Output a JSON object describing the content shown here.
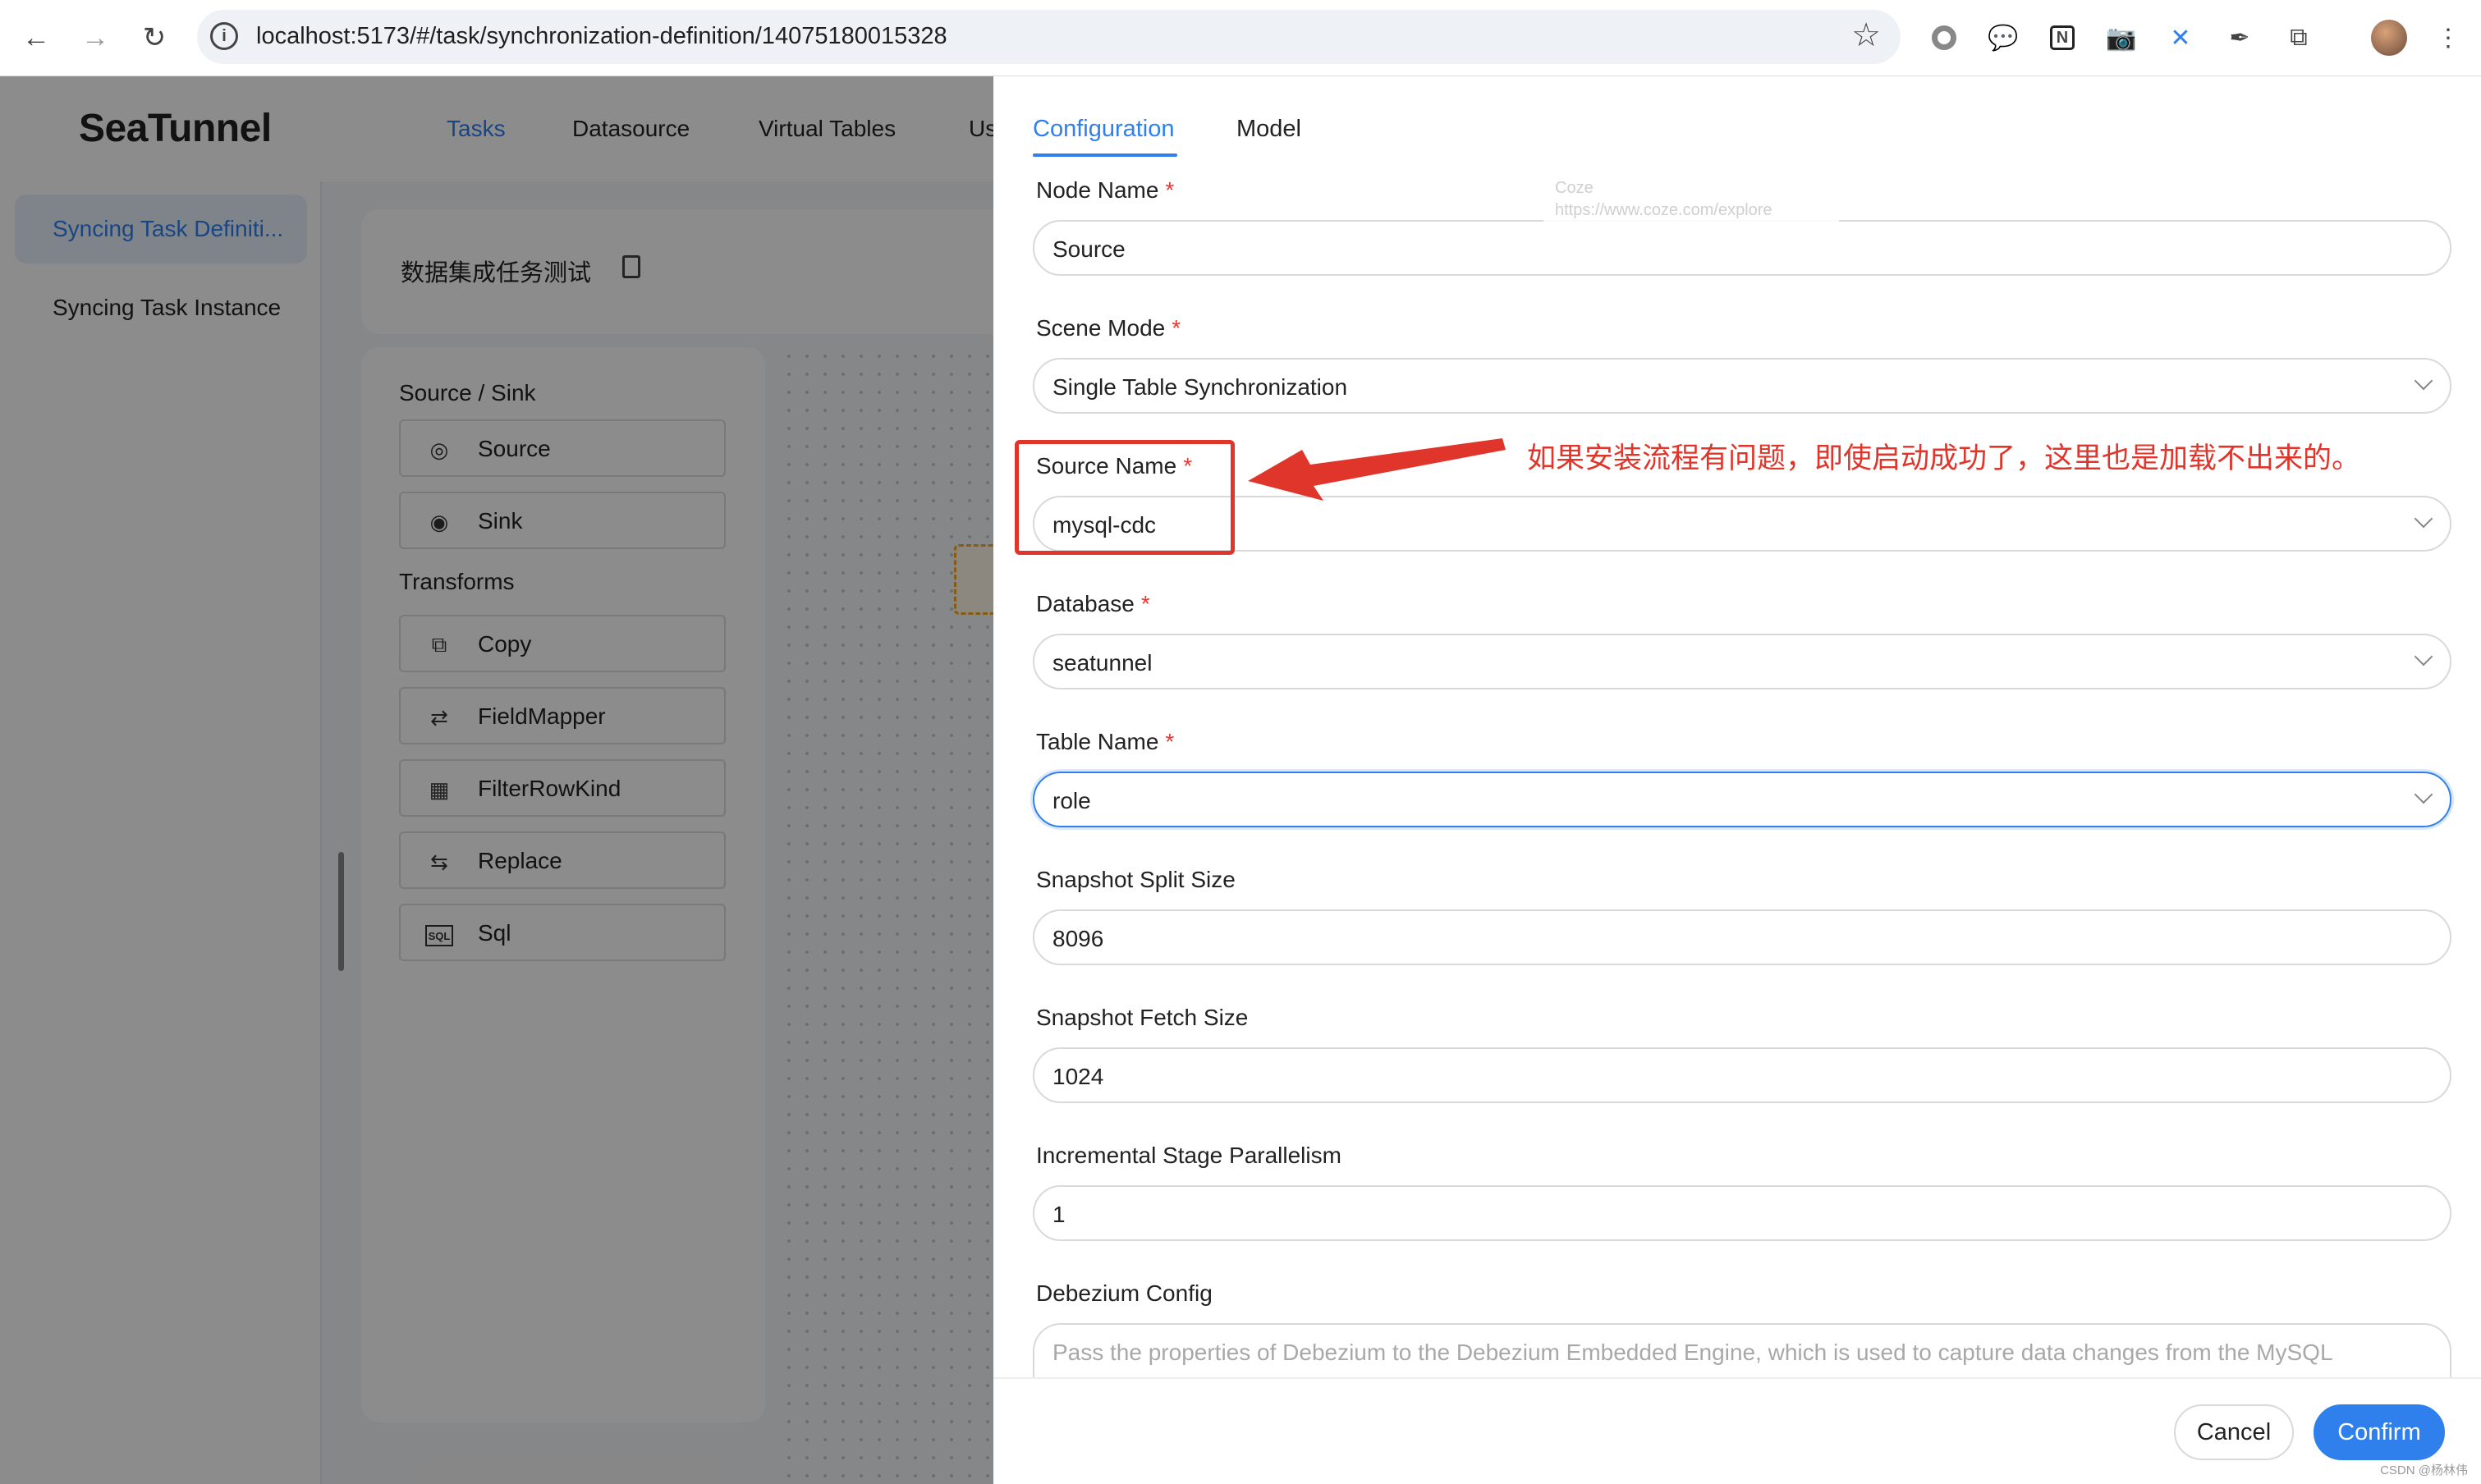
{
  "browser": {
    "url": "localhost:5173/#/task/synchronization-definition/14075180015328",
    "back_icon": "←",
    "forward_icon": "→",
    "reload_icon": "↻",
    "star_icon": "☆"
  },
  "app": {
    "logo": "SeaTunnel",
    "topnav": [
      "Tasks",
      "Datasource",
      "Virtual Tables",
      "Us"
    ],
    "sidebar": [
      "Syncing Task Definiti...",
      "Syncing Task Instance"
    ],
    "task_name": "数据集成任务测试",
    "palette": {
      "source_sink_heading": "Source / Sink",
      "source_sink": [
        "Source",
        "Sink"
      ],
      "transforms_heading": "Transforms",
      "transforms": [
        "Copy",
        "FieldMapper",
        "FilterRowKind",
        "Replace",
        "Sql"
      ]
    }
  },
  "drawer": {
    "tabs": [
      "Configuration",
      "Model"
    ],
    "fields": {
      "node_name": {
        "label": "Node Name",
        "value": "Source"
      },
      "scene_mode": {
        "label": "Scene Mode",
        "value": "Single Table Synchronization"
      },
      "source_name": {
        "label": "Source Name",
        "value": "mysql-cdc"
      },
      "database": {
        "label": "Database",
        "value": "seatunnel"
      },
      "table_name": {
        "label": "Table Name",
        "value": "role"
      },
      "snapshot_split_size": {
        "label": "Snapshot Split Size",
        "value": "8096"
      },
      "snapshot_fetch_size": {
        "label": "Snapshot Fetch Size",
        "value": "1024"
      },
      "incremental_parallelism": {
        "label": "Incremental Stage Parallelism",
        "value": "1"
      },
      "debezium_config": {
        "label": "Debezium Config",
        "placeholder": "Pass the properties of Debezium to the Debezium Embedded Engine, which is used to capture data changes from the MySQL"
      }
    },
    "required_mark": "*",
    "cancel": "Cancel",
    "confirm": "Confirm"
  },
  "overlay": {
    "coze_title": "Coze",
    "coze_url": "https://www.coze.com/explore",
    "annotation_text": "如果安装流程有问题，即使启动成功了，这里也是加载不出来的。",
    "annotation_color": "#e0352b"
  },
  "watermark": "CSDN @杨林伟",
  "colors": {
    "accent": "#2f80ed",
    "required": "#e53935"
  }
}
